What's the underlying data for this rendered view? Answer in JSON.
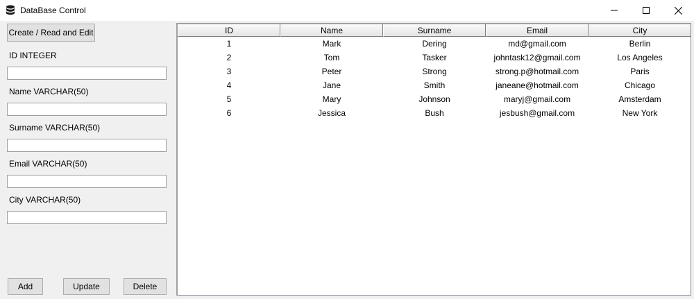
{
  "window": {
    "title": "DataBase Control",
    "app_icon": "database-icon",
    "controls": [
      "minimize-icon",
      "maximize-icon",
      "close-icon"
    ]
  },
  "left_panel": {
    "mode_button": "Create / Read and Edit",
    "fields": [
      {
        "label": "ID INTEGER",
        "value": "",
        "placeholder": ""
      },
      {
        "label": "Name VARCHAR(50)",
        "value": "",
        "placeholder": ""
      },
      {
        "label": "Surname VARCHAR(50)",
        "value": "",
        "placeholder": ""
      },
      {
        "label": "Email VARCHAR(50)",
        "value": "",
        "placeholder": ""
      },
      {
        "label": "City VARCHAR(50)",
        "value": "",
        "placeholder": ""
      }
    ],
    "actions": {
      "add": "Add",
      "update": "Update",
      "delete": "Delete"
    }
  },
  "table": {
    "columns": [
      "ID",
      "Name",
      "Surname",
      "Email",
      "City"
    ],
    "rows": [
      [
        "1",
        "Mark",
        "Dering",
        "md@gmail.com",
        "Berlin"
      ],
      [
        "2",
        "Tom",
        "Tasker",
        "johntask12@gmail.com",
        "Los Angeles"
      ],
      [
        "3",
        "Peter",
        "Strong",
        "strong.p@hotmail.com",
        "Paris"
      ],
      [
        "4",
        "Jane",
        "Smith",
        "janeane@hotmail.com",
        "Chicago"
      ],
      [
        "5",
        "Mary",
        "Johnson",
        "maryj@gmail.com",
        "Amsterdam"
      ],
      [
        "6",
        "Jessica",
        "Bush",
        "jesbush@gmail.com",
        "New York"
      ]
    ]
  }
}
